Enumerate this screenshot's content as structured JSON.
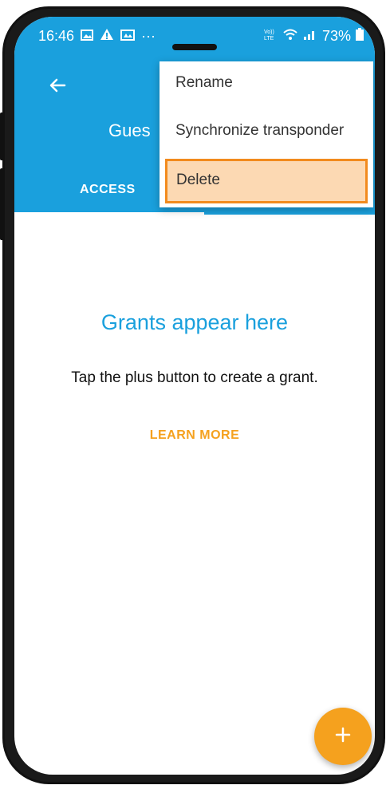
{
  "status_bar": {
    "time": "16:46",
    "more_indicator": "···",
    "battery": "73%",
    "icons": [
      "image-icon",
      "warning-icon",
      "gallery-icon",
      "volte-icon",
      "wifi-icon",
      "signal-icon",
      "battery-icon"
    ]
  },
  "header": {
    "title": "Gues",
    "tab_access": "ACCESS",
    "color": "#1aa0dd"
  },
  "menu": {
    "items": [
      {
        "label": "Rename"
      },
      {
        "label": "Synchronize transponder"
      },
      {
        "label": "Delete"
      }
    ],
    "highlight_fill": "#fcd9b3",
    "highlight_border": "#f28b1e"
  },
  "empty_state": {
    "title": "Grants appear here",
    "description": "Tap the plus button to create a grant.",
    "learn_more": "LEARN MORE"
  },
  "fab": {
    "label": "+",
    "color": "#f5a11e"
  }
}
